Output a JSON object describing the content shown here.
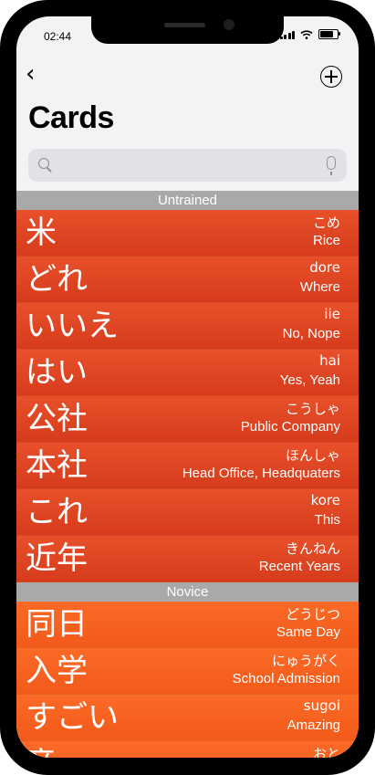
{
  "status": {
    "time": "02:44"
  },
  "nav": {
    "title": "Cards",
    "back_icon": "chevron-left-icon",
    "add_icon": "plus-circle-icon"
  },
  "search": {
    "value": "",
    "placeholder": ""
  },
  "sections": [
    {
      "header": "Untrained",
      "rows": [
        {
          "kanji": "米",
          "reading": "こめ",
          "meaning": "Rice"
        },
        {
          "kanji": "どれ",
          "reading": "dore",
          "meaning": "Where"
        },
        {
          "kanji": "いいえ",
          "reading": "iie",
          "meaning": "No, Nope"
        },
        {
          "kanji": "はい",
          "reading": "hai",
          "meaning": "Yes, Yeah"
        },
        {
          "kanji": "公社",
          "reading": "こうしゃ",
          "meaning": "Public Company"
        },
        {
          "kanji": "本社",
          "reading": "ほんしゃ",
          "meaning": "Head Office, Headquaters"
        },
        {
          "kanji": "これ",
          "reading": "kore",
          "meaning": "This"
        },
        {
          "kanji": "近年",
          "reading": "きんねん",
          "meaning": "Recent Years"
        }
      ]
    },
    {
      "header": "Novice",
      "rows": [
        {
          "kanji": "同日",
          "reading": "どうじつ",
          "meaning": "Same Day"
        },
        {
          "kanji": "入学",
          "reading": "にゅうがく",
          "meaning": "School Admission"
        },
        {
          "kanji": "すごい",
          "reading": "sugoi",
          "meaning": "Amazing"
        },
        {
          "kanji": "音",
          "reading": "おと",
          "meaning": ""
        }
      ]
    }
  ],
  "colors": {
    "untrained": "#e0461f",
    "novice": "#f8631f",
    "section_header": "#a9a9a9"
  }
}
